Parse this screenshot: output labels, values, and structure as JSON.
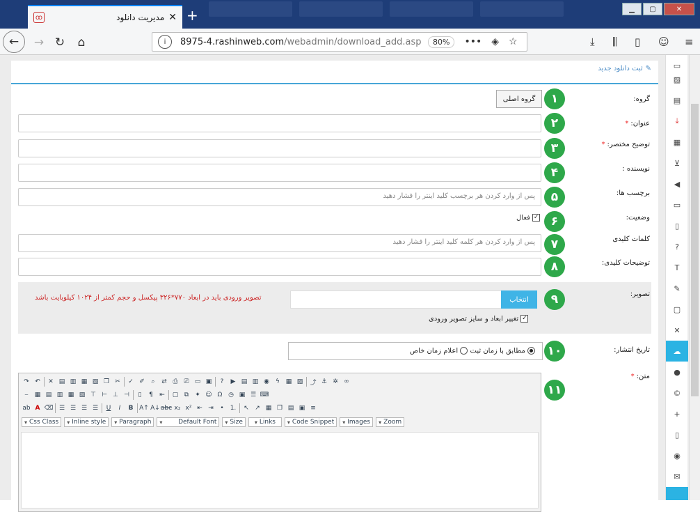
{
  "browser": {
    "tab_title": "مدیریت دانلود",
    "tab_close": "✕",
    "new_tab": "+",
    "url_host": "8975-4.rashinweb.com",
    "url_path": "/webadmin/download_add.asp",
    "zoom": "80%",
    "window_min": "▁",
    "window_max": "▢",
    "window_close": "✕"
  },
  "header": {
    "title": "ثبت دانلود جدید"
  },
  "form": {
    "group": {
      "label": "گروه:",
      "button": "گروه اصلی",
      "step": "۱"
    },
    "title": {
      "label": "عنوان:",
      "required": "*",
      "step": "۲"
    },
    "short_desc": {
      "label": "توضیح مختصر:",
      "required": "*",
      "step": "۳"
    },
    "author": {
      "label": "نویسنده :",
      "step": "۴"
    },
    "tags": {
      "label": "برچسب ها:",
      "placeholder": "پس از وارد کردن هر برچسب کلید اینتر را فشار دهید",
      "step": "۵"
    },
    "status": {
      "label": "وضعیت:",
      "checkbox_label": "فعال",
      "checked": true,
      "step": "۶"
    },
    "keywords": {
      "label": "کلمات کلیدی",
      "placeholder": "پس از وارد کردن هر کلمه کلید اینتر را فشار دهید",
      "step": "۷"
    },
    "keyword_desc": {
      "label": "توضیحات کلیدی:",
      "step": "۸"
    },
    "image": {
      "label": "تصویر:",
      "pick_button": "انتخاب",
      "warning": "تصویر ورودی باید در ابعاد ۷۷۰*۳۲۶ پیکسل و حجم کمتر از ۱۰۲۴ کیلوبایت باشد",
      "resize_label": "تغییر ابعاد و سایز تصویر ورودی",
      "step": "۹"
    },
    "publish_date": {
      "label": "تاریخ انتشار:",
      "option_now": "مطابق با زمان ثبت",
      "option_custom": "اعلام زمان خاص",
      "step": "۱۰"
    },
    "body": {
      "label": "متن:",
      "required": "*",
      "step": "۱۱"
    }
  },
  "editor": {
    "dropdowns": [
      "Css Class",
      "Inline style",
      "Paragraph",
      "Default Font",
      "Size",
      "Links",
      "Code Snippet",
      "Images",
      "Zoom"
    ],
    "bold": "B",
    "italic": "I",
    "underline": "U"
  }
}
